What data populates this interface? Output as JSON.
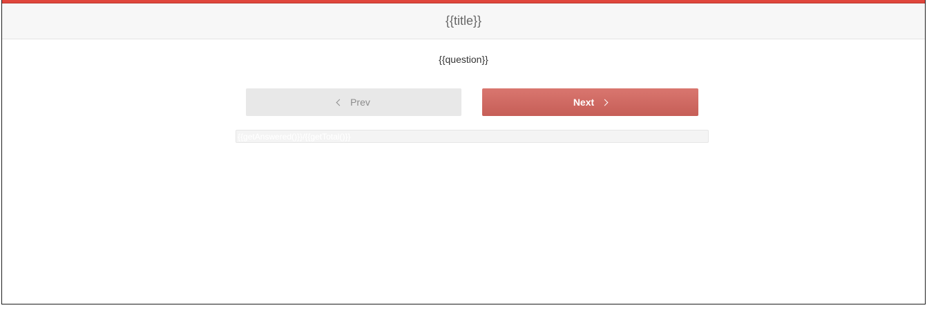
{
  "header": {
    "title": "{{title}}"
  },
  "question": {
    "text": "{{question}}"
  },
  "navigation": {
    "prev_label": "Prev",
    "next_label": "Next"
  },
  "progress": {
    "label": "{{getAnswered()}}/{{getTotal()}}"
  },
  "colors": {
    "accent": "#e0463c",
    "next_button": "#cb665f",
    "prev_button": "#e8e8e8",
    "header_bg": "#f7f7f7"
  },
  "icons": {
    "prev": "chevron-left-icon",
    "next": "chevron-right-icon"
  }
}
